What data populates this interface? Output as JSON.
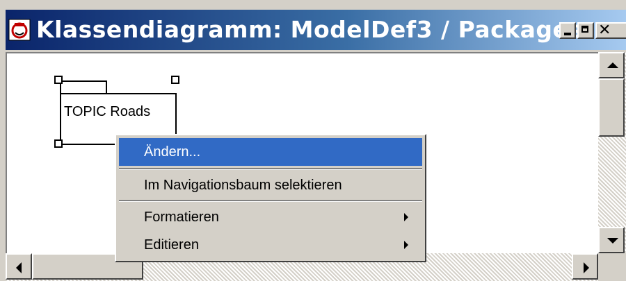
{
  "window": {
    "title": "Klassendiagramm: ModelDef3 / Packages",
    "controls": {
      "minimize": "minimize-icon",
      "maximize": "maximize-icon",
      "close_glyph": "✕"
    }
  },
  "diagram": {
    "package": {
      "name": "TOPIC Roads"
    }
  },
  "context_menu": {
    "items": [
      {
        "label": "Ändern...",
        "selected": true,
        "has_submenu": false
      },
      {
        "label": "Im Navigationsbaum selektieren",
        "selected": false,
        "has_submenu": false
      },
      {
        "label": "Formatieren",
        "selected": false,
        "has_submenu": true
      },
      {
        "label": "Editieren",
        "selected": false,
        "has_submenu": true
      }
    ]
  },
  "colors": {
    "title_gradient_start": "#0a246a",
    "title_gradient_end": "#a6caf0",
    "menu_highlight": "#316ac5",
    "chrome": "#d4d0c8"
  }
}
